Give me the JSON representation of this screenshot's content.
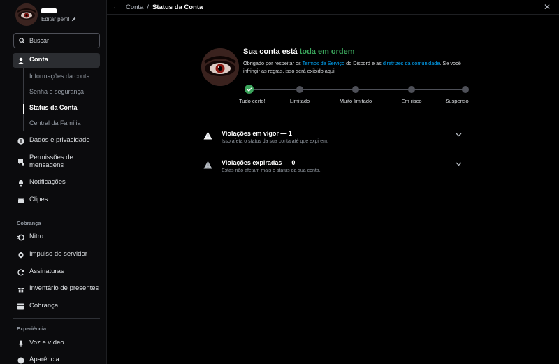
{
  "profile": {
    "edit_label": "Editar perfil"
  },
  "search": {
    "placeholder": "Buscar"
  },
  "nav": {
    "conta": "Conta",
    "sub": [
      "Informações da conta",
      "Senha e segurança",
      "Status da Conta",
      "Central da Família"
    ],
    "dados": "Dados e privacidade",
    "permissoes": "Permissões de mensagens",
    "notificacoes": "Notificações",
    "clipes": "Clipes",
    "billing_header": "Cobrança",
    "nitro": "Nitro",
    "impulso": "Impulso de servidor",
    "assinaturas": "Assinaturas",
    "inventario": "Inventário de presentes",
    "cobranca": "Cobrança",
    "experience_header": "Experiência",
    "voz": "Voz e vídeo",
    "aparencia": "Aparência"
  },
  "header": {
    "crumb_parent": "Conta",
    "crumb_sep": "/",
    "crumb_current": "Status da Conta"
  },
  "status": {
    "title_prefix": "Sua conta está ",
    "title_highlight": "toda em ordem",
    "desc_1": "Obrigado por respeitar os ",
    "link_tos": "Termos de Serviço",
    "desc_2": " do Discord e as ",
    "link_guidelines": "diretrizes da comunidade",
    "desc_3": ". Se você infringir as regras, isso será exibido aqui.",
    "steps": [
      "Tudo certo!",
      "Limitado",
      "Muito limitado",
      "Em risco",
      "Suspenso"
    ],
    "current_step": 0
  },
  "violations": {
    "active_title": "Violações em vigor — 1",
    "active_sub": "Isso afeta o status da sua conta até que expirem.",
    "expired_title": "Violações expiradas — 0",
    "expired_sub": "Estas não afetam mais o status da sua conta."
  },
  "colors": {
    "accent_green": "#3ba55c",
    "link_blue": "#00a8fc",
    "active_bg": "#2b2d31"
  }
}
